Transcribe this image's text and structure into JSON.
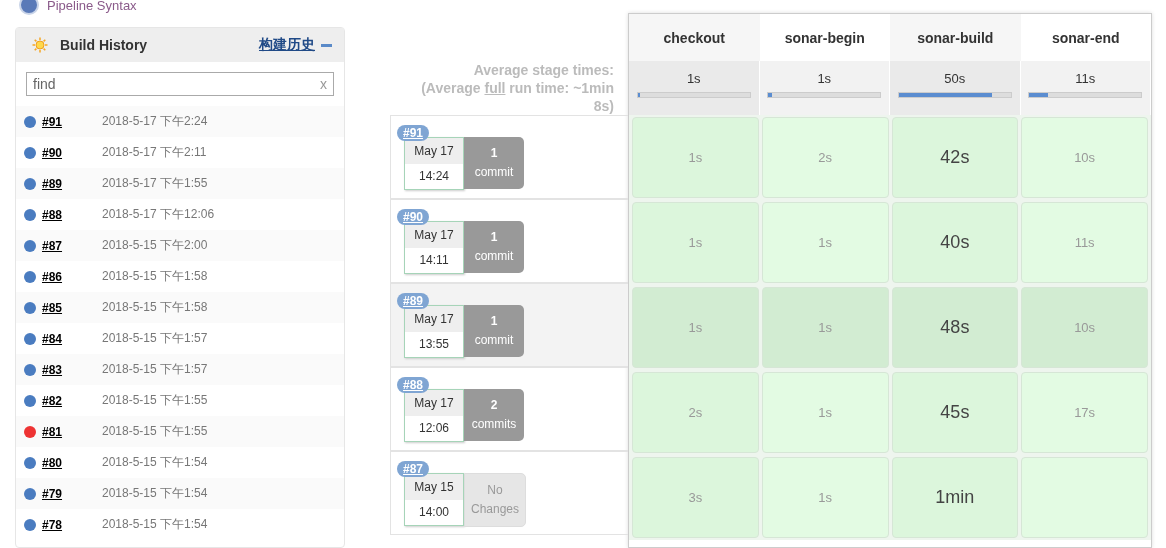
{
  "top_link": {
    "label": "Pipeline Syntax"
  },
  "build_history": {
    "title": "Build History",
    "trend_link": "构建历史",
    "search": {
      "placeholder": "find",
      "clear": "x"
    },
    "builds": [
      {
        "number": "#91",
        "time": "2018-5-17 下午2:24",
        "color": "#4a7cc0"
      },
      {
        "number": "#90",
        "time": "2018-5-17 下午2:11",
        "color": "#4a7cc0"
      },
      {
        "number": "#89",
        "time": "2018-5-17 下午1:55",
        "color": "#4a7cc0"
      },
      {
        "number": "#88",
        "time": "2018-5-17 下午12:06",
        "color": "#4a7cc0"
      },
      {
        "number": "#87",
        "time": "2018-5-15 下午2:00",
        "color": "#4a7cc0"
      },
      {
        "number": "#86",
        "time": "2018-5-15 下午1:58",
        "color": "#4a7cc0"
      },
      {
        "number": "#85",
        "time": "2018-5-15 下午1:58",
        "color": "#4a7cc0"
      },
      {
        "number": "#84",
        "time": "2018-5-15 下午1:57",
        "color": "#4a7cc0"
      },
      {
        "number": "#83",
        "time": "2018-5-15 下午1:57",
        "color": "#4a7cc0"
      },
      {
        "number": "#82",
        "time": "2018-5-15 下午1:55",
        "color": "#4a7cc0"
      },
      {
        "number": "#81",
        "time": "2018-5-15 下午1:55",
        "color": "#ee3333"
      },
      {
        "number": "#80",
        "time": "2018-5-15 下午1:54",
        "color": "#4a7cc0"
      },
      {
        "number": "#79",
        "time": "2018-5-15 下午1:54",
        "color": "#4a7cc0"
      },
      {
        "number": "#78",
        "time": "2018-5-15 下午1:54",
        "color": "#4a7cc0"
      }
    ]
  },
  "stage_view": {
    "average_label": "Average stage times:",
    "average_full": "(Average **full** run time: ~1min 8s)",
    "stages": [
      {
        "name": "checkout",
        "average": "1s",
        "level": 0.02,
        "emphasized": false
      },
      {
        "name": "sonar-begin",
        "average": "1s",
        "level": 0.03,
        "emphasized": false
      },
      {
        "name": "sonar-build",
        "average": "50s",
        "level": 0.83,
        "emphasized": true
      },
      {
        "name": "sonar-end",
        "average": "11s",
        "level": 0.17,
        "emphasized": false
      }
    ],
    "runs": [
      {
        "number": "#91",
        "date": "May 17",
        "time": "14:24",
        "changes_count": "1",
        "changes_label": "commit",
        "has_changes": true,
        "highlighted": false,
        "durations": [
          "1s",
          "2s",
          "42s",
          "10s"
        ]
      },
      {
        "number": "#90",
        "date": "May 17",
        "time": "14:11",
        "changes_count": "1",
        "changes_label": "commit",
        "has_changes": true,
        "highlighted": false,
        "durations": [
          "1s",
          "1s",
          "40s",
          "11s"
        ]
      },
      {
        "number": "#89",
        "date": "May 17",
        "time": "13:55",
        "changes_count": "1",
        "changes_label": "commit",
        "has_changes": true,
        "highlighted": true,
        "durations": [
          "1s",
          "1s",
          "48s",
          "10s"
        ]
      },
      {
        "number": "#88",
        "date": "May 17",
        "time": "12:06",
        "changes_count": "2",
        "changes_label": "commits",
        "has_changes": true,
        "highlighted": false,
        "durations": [
          "2s",
          "1s",
          "45s",
          "17s"
        ]
      },
      {
        "number": "#87",
        "date": "May 15",
        "time": "14:00",
        "changes_count": "No",
        "changes_label": "Changes",
        "has_changes": false,
        "highlighted": false,
        "durations": [
          "3s",
          "1s",
          "1min"
        ]
      }
    ]
  }
}
